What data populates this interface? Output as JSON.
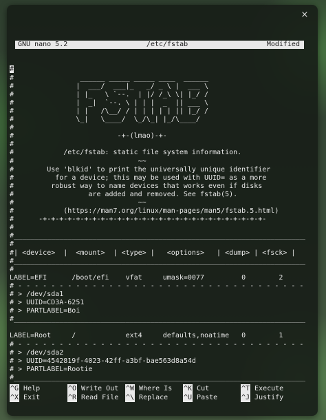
{
  "window": {
    "close_glyph": "×"
  },
  "nano": {
    "version": "GNU nano 5.2",
    "filename": "/etc/fstab",
    "state": "Modified"
  },
  "gutter_char": "#",
  "content_lines": [
    "",
    "                ______ _____ _____ ____  ______",
    "               |  ___/  ___|_   _/ _ \\ |  ___ \\",
    "               | |_   \\ `--.  | |/ /_\\ \\| |_/ /",
    "               |  _|  `--. \\ | | |  _  || ___ \\",
    "               | |   /\\__/ / | | | | | || |_/ /",
    "               \\_|   \\____/  \\_/\\_| |_/\\____/",
    "",
    "                         -+-(lmao)-+-",
    "",
    "            /etc/fstab: static file system information.",
    "                              ~~",
    "        Use 'blkid' to print the universally unique identifier",
    "          for a device; this may be used with UUID= as a more",
    "         robust way to name devices that works even if disks",
    "                  are added and removed. See fstab(5).",
    "                              ~~",
    "            (https://man7.org/linux/man-pages/man5/fstab.5.html)",
    "      -+-+-+-+-+-+-+-+-+-+-+-+-+-+-+-+-+-+-+-+-+-+-+-+-+-+-+-",
    "",
    "_______________________________________________________________________",
    "",
    "| <device>  |  <mount>  | <type> |   <options>   | <dump> | <fsck> |",
    "_______________________________________________________________________",
    ""
  ],
  "entries_lines": [
    "LABEL=EFI      /boot/efi    vfat     umask=0077         0        2",
    "# - - - - - - - - - - - - - - - - - - - - - - - - - - - - - - - - - - -",
    "# > /dev/sda1",
    "# > UUID=CD3A-6251",
    "# > PARTLABEL=Boi",
    "#________________________________________________________________________",
    "",
    "LABEL=Root     /            ext4     defaults,noatime   0        1",
    "# - - - - - - - - - - - - - - - - - - - - - - - - - - - - - - - - - - -",
    "# > /dev/sda2",
    "# > UUID=4542819f-4023-42ff-a3bf-bae563d8a54d",
    "# > PARTLABEL=Rootie",
    "#________________________________________________________________________",
    ""
  ],
  "shortcuts": [
    [
      {
        "key": "^G",
        "label": "Help"
      },
      {
        "key": "^O",
        "label": "Write Out"
      },
      {
        "key": "^W",
        "label": "Where Is"
      },
      {
        "key": "^K",
        "label": "Cut"
      },
      {
        "key": "^T",
        "label": "Execute"
      }
    ],
    [
      {
        "key": "^X",
        "label": "Exit"
      },
      {
        "key": "^R",
        "label": "Read File"
      },
      {
        "key": "^\\",
        "label": "Replace"
      },
      {
        "key": "^U",
        "label": "Paste"
      },
      {
        "key": "^J",
        "label": "Justify"
      }
    ]
  ]
}
